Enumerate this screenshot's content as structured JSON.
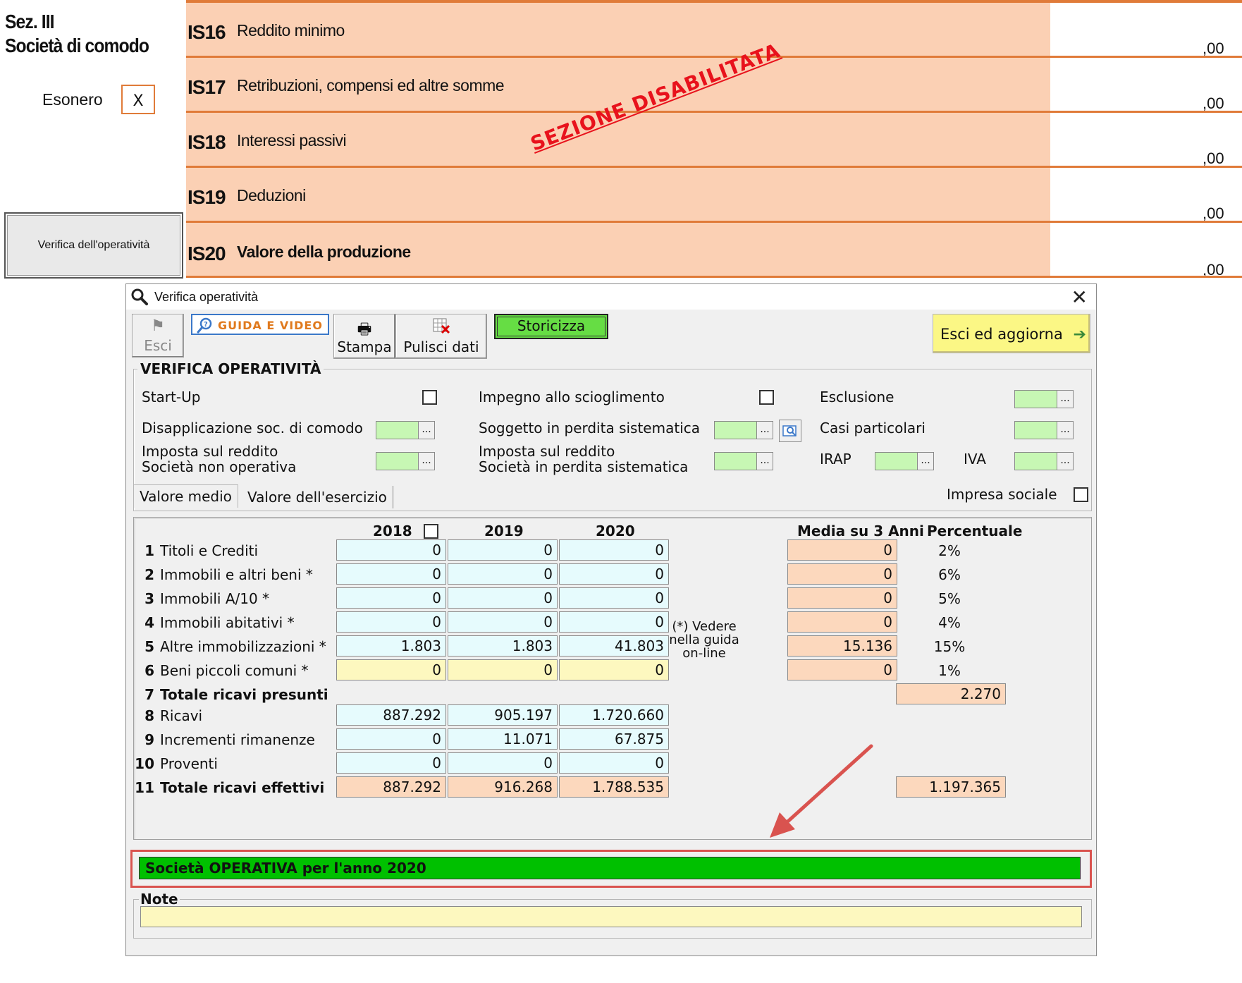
{
  "form": {
    "section_line1": "Sez. III",
    "section_line2": "Società di comodo",
    "esonero_label": "Esonero",
    "esonero_value": "X",
    "verify_button": "Verifica dell'operatività",
    "disabled_stamp": "SEZIONE DISABILITATA",
    "rows": [
      {
        "code": "IS16",
        "desc": "Reddito minimo",
        "value": ",00"
      },
      {
        "code": "IS17",
        "desc": "Retribuzioni, compensi ed altre somme",
        "value": ",00"
      },
      {
        "code": "IS18",
        "desc": "Interessi passivi",
        "value": ",00"
      },
      {
        "code": "IS19",
        "desc": "Deduzioni",
        "value": ",00"
      },
      {
        "code": "IS20",
        "desc": "Valore della produzione",
        "value": ",00"
      }
    ]
  },
  "dialog": {
    "title": "Verifica operatività",
    "toolbar": {
      "esci": "Esci",
      "guida": "GUIDA E VIDEO",
      "stampa": "Stampa",
      "pulisci": "Pulisci dati",
      "storicizza": "Storicizza",
      "esci_aggiorna": "Esci ed aggiorna"
    },
    "verifica": {
      "group_title": "VERIFICA OPERATIVITÀ",
      "startup": "Start-Up",
      "impegno": "Impegno allo scioglimento",
      "esclusione": "Esclusione",
      "disapplicazione": "Disapplicazione soc. di comodo",
      "soggetto_perdita": "Soggetto in perdita sistematica",
      "casi_particolari": "Casi particolari",
      "imposta_nonop_1": "Imposta sul reddito",
      "imposta_nonop_2": "Società non operativa",
      "imposta_perdita_1": "Imposta sul reddito",
      "imposta_perdita_2": "Società in perdita sistematica",
      "irap": "IRAP",
      "iva": "IVA",
      "dots": "..."
    },
    "tabs": [
      "Valore medio",
      "Valore dell'esercizio"
    ],
    "impresa_sociale": "Impresa sociale",
    "table": {
      "years": [
        "2018",
        "2019",
        "2020"
      ],
      "media_header": "Media su 3 Anni",
      "perc_header": "Percentuale",
      "rows": [
        {
          "num": "1",
          "label": "Titoli e Crediti",
          "v": [
            "0",
            "0",
            "0"
          ],
          "media": "0",
          "pct": "2%"
        },
        {
          "num": "2",
          "label": "Immobili e altri beni  *",
          "v": [
            "0",
            "0",
            "0"
          ],
          "media": "0",
          "pct": "6%"
        },
        {
          "num": "3",
          "label": "Immobili A/10 *",
          "v": [
            "0",
            "0",
            "0"
          ],
          "media": "0",
          "pct": "5%"
        },
        {
          "num": "4",
          "label": "Immobili abitativi *",
          "v": [
            "0",
            "0",
            "0"
          ],
          "media": "0",
          "pct": "4%"
        },
        {
          "num": "5",
          "label": "Altre immobilizzazioni *",
          "v": [
            "1.803",
            "1.803",
            "41.803"
          ],
          "media": "15.136",
          "pct": "15%"
        },
        {
          "num": "6",
          "label": "Beni piccoli comuni  *",
          "v": [
            "0",
            "0",
            "0"
          ],
          "media": "0",
          "pct": "1%"
        },
        {
          "num": "7",
          "label": "Totale ricavi presunti",
          "total": "2.270"
        },
        {
          "num": "8",
          "label": "Ricavi",
          "v": [
            "887.292",
            "905.197",
            "1.720.660"
          ]
        },
        {
          "num": "9",
          "label": "Incrementi rimanenze",
          "v": [
            "0",
            "11.071",
            "67.875"
          ]
        },
        {
          "num": "10",
          "label": "Proventi",
          "v": [
            "0",
            "0",
            "0"
          ]
        },
        {
          "num": "11",
          "label": "Totale ricavi effettivi",
          "v": [
            "887.292",
            "916.268",
            "1.788.535"
          ],
          "total": "1.197.365"
        }
      ],
      "note_line1": "(*) Vedere",
      "note_line2": "nella guida",
      "note_line3": "on-line"
    },
    "status": "Società OPERATIVA per l'anno 2020",
    "note_label": "Note",
    "note_value": ""
  },
  "colors": {
    "accent_orange": "#e07b39",
    "band": "#fbd0b4",
    "status_green": "#00c000",
    "stamp_red": "#e8121c",
    "arrow_red": "#d9534f"
  }
}
